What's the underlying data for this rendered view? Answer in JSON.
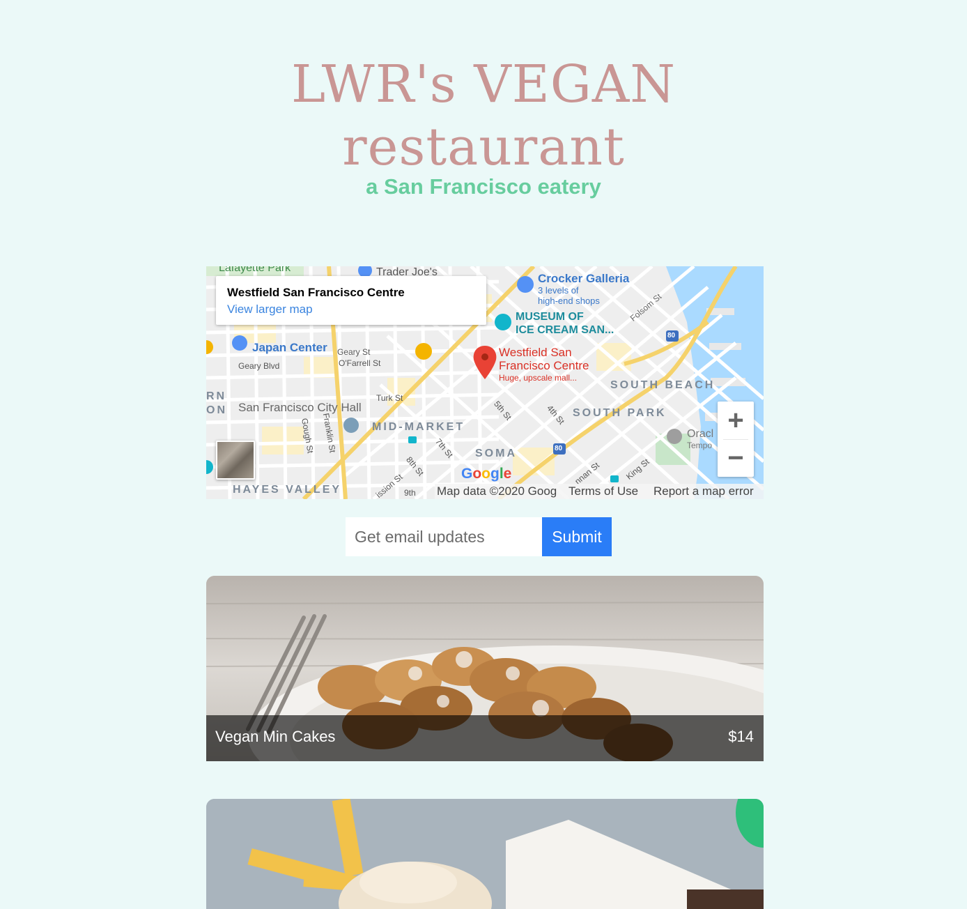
{
  "header": {
    "title_line1": "LWR's VEGAN",
    "title_line2": "restaurant",
    "subtitle": "a San Francisco eatery"
  },
  "map": {
    "place_name": "Westfield San Francisco Centre",
    "view_larger": "View larger map",
    "marker_title_line1": "Westfield San",
    "marker_title_line2": "Francisco Centre",
    "marker_desc": "Huge, upscale mall...",
    "labels": {
      "lafayette": "Lafayette Park",
      "trader_joes": "Trader Joe's",
      "crocker": "Crocker Galleria",
      "crocker_desc1": "3 levels of",
      "crocker_desc2": "high-end shops",
      "museum1": "MUSEUM OF",
      "museum2": "ICE CREAM SAN...",
      "folsom": "Folsom St",
      "japan_center": "Japan Center",
      "geary_st": "Geary St",
      "ofarrell": "O'Farrell St",
      "geary_blvd": "Geary Blvd",
      "south_beach": "SOUTH BEACH",
      "sf_city_hall": "San Francisco City Hall",
      "turk": "Turk St",
      "fifth": "5th St",
      "fourth": "4th St",
      "south_park": "SOUTH PARK",
      "mid_market": "MID-MARKET",
      "oracle": "Oracl",
      "oracle2": "Tempo",
      "gough": "Gough St",
      "franklin": "Franklin St",
      "seventh": "7th St",
      "soma": "SOMA",
      "eighth": "8th St",
      "brannan": "nnan St",
      "king": "King St",
      "mission": "ission St",
      "ninth": "9th",
      "hayes": "HAYES VALLEY",
      "rn": "RN",
      "on": "ON",
      "i80": "80",
      "i80b": "80"
    },
    "google_logo": "Google",
    "zoom_in": "+",
    "zoom_out": "−",
    "footer": {
      "map_data": "Map data ©2020 Goog",
      "terms": "Terms of Use",
      "report": "Report a map error"
    }
  },
  "email_form": {
    "placeholder": "Get email updates",
    "value": "",
    "submit_label": "Submit"
  },
  "menu": [
    {
      "name": "Vegan Min Cakes",
      "price": "$14"
    },
    {
      "name": "",
      "price": ""
    }
  ],
  "colors": {
    "background": "#ebf9f8",
    "title": "#c99694",
    "subtitle": "#67cd9e",
    "submit": "#2a7df7"
  }
}
